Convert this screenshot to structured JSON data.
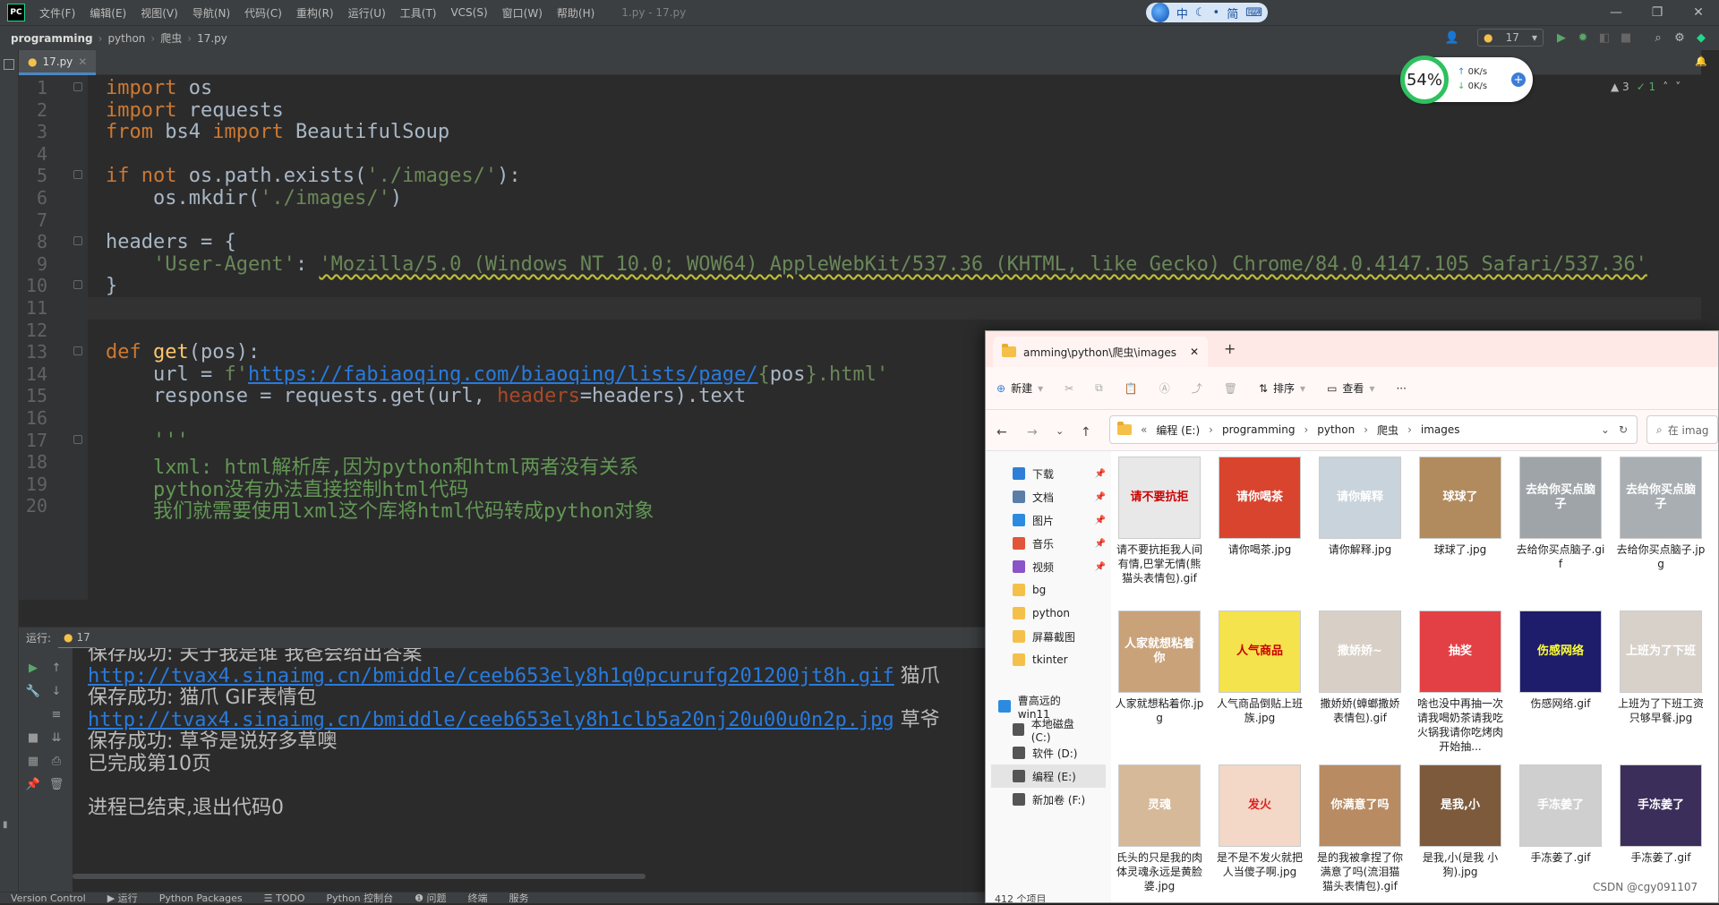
{
  "menubar": {
    "logo": "PC",
    "items": [
      "文件(F)",
      "编辑(E)",
      "视图(V)",
      "导航(N)",
      "代码(C)",
      "重构(R)",
      "运行(U)",
      "工具(T)",
      "VCS(S)",
      "窗口(W)",
      "帮助(H)"
    ],
    "window_title": "1.py - 17.py",
    "ime": [
      "中",
      "简"
    ]
  },
  "navbar": {
    "crumbs": [
      "programming",
      "python",
      "爬虫",
      "17.py"
    ],
    "run_config": "17"
  },
  "editor": {
    "tab": "17.py",
    "inspect": [
      "▲ 3",
      "✓ 1"
    ],
    "lines": [
      {
        "n": "1",
        "html": "<span class='kw'>import</span> os"
      },
      {
        "n": "2",
        "html": "<span class='kw'>import</span> requests"
      },
      {
        "n": "3",
        "html": "<span class='kw'>from</span> bs4 <span class='kw'>import</span> BeautifulSoup"
      },
      {
        "n": "4",
        "html": ""
      },
      {
        "n": "5",
        "html": "<span class='kw'>if not</span> os.path.exists(<span class='str'>'./images/'</span>):"
      },
      {
        "n": "6",
        "html": "    os.mkdir(<span class='str'>'./images/'</span>)"
      },
      {
        "n": "7",
        "html": ""
      },
      {
        "n": "8",
        "html": "headers = {"
      },
      {
        "n": "9",
        "html": "    <span class='str'>'User-Agent'</span>: <span class='str wavy'>'Mozilla/5.0 (Windows NT 10.0; WOW64) AppleWebKit/537.36 (KHTML, like Gecko) Chrome/84.0.4147.105 Safari/537.36'</span>"
      },
      {
        "n": "10",
        "html": "}"
      },
      {
        "n": "11",
        "html": ""
      },
      {
        "n": "12",
        "html": ""
      },
      {
        "n": "13",
        "html": "<span class='kw'>def</span> <span class='fn'>get</span>(pos):"
      },
      {
        "n": "14",
        "html": "    url = <span class='str'>f'<span class='url'>https://fabiaoqing.com/biaoqing/lists/page/</span>{</span>pos<span class='str'>}.html'</span>"
      },
      {
        "n": "15",
        "html": "    response = requests.get(url, <span class='param'>headers</span>=headers).text"
      },
      {
        "n": "16",
        "html": ""
      },
      {
        "n": "17",
        "html": "    <span class='cmt'>'''</span>"
      },
      {
        "n": "18",
        "html": "    <span class='cmt'>lxml: html解析库,因为python和html两者没有关系</span>"
      },
      {
        "n": "19",
        "html": "    <span class='cmt'>python没有办法直接控制html代码</span>"
      },
      {
        "n": "20",
        "html": "    <span class='cmt'>我们就需要使用lxml这个库将html代码转成python对象</span>"
      }
    ]
  },
  "netwidget": {
    "percent": "54%",
    "up": "0K/s",
    "down": "0K/s"
  },
  "run": {
    "label": "运行:",
    "tab": "17",
    "lines": [
      {
        "kind": "text",
        "text": "保存成功: 关于我是谁 我爸会给出答案"
      },
      {
        "kind": "url",
        "url": "http://tvax4.sinaimg.cn/bmiddle/ceeb653ely8h1q0pcurufg201200jt8h.gif",
        "rest": " 猫爪"
      },
      {
        "kind": "text",
        "text": "保存成功: 猫爪 GIF表情包"
      },
      {
        "kind": "url",
        "url": "http://tvax4.sinaimg.cn/bmiddle/ceeb653ely8h1clb5a20nj20u00u0n2p.jpg",
        "rest": " 草爷"
      },
      {
        "kind": "text",
        "text": "保存成功: 草爷是说好多草噢"
      },
      {
        "kind": "text",
        "text": "已完成第10页"
      },
      {
        "kind": "text",
        "text": ""
      },
      {
        "kind": "text",
        "text": "进程已结束,退出代码0"
      }
    ]
  },
  "bottombar": [
    "Version Control",
    "▶ 运行",
    "Python Packages",
    "☰ TODO",
    "Python 控制台",
    "❶ 问题",
    "终端",
    "服务"
  ],
  "explorer": {
    "tab": "amming\\python\\爬虫\\images",
    "commands": [
      "新建",
      "排序",
      "查看",
      "···"
    ],
    "path": [
      "编程 (E:)",
      "programming",
      "python",
      "爬虫",
      "images"
    ],
    "search_placeholder": "在 imag",
    "sidebar": [
      {
        "label": "下载",
        "color": "#2f7fd6",
        "pin": true
      },
      {
        "label": "文档",
        "color": "#5a7ea8",
        "pin": true
      },
      {
        "label": "图片",
        "color": "#2c8be0",
        "pin": true
      },
      {
        "label": "音乐",
        "color": "#e2553a",
        "pin": true
      },
      {
        "label": "视频",
        "color": "#8a53c7",
        "pin": true
      },
      {
        "label": "bg",
        "color": "#f5c04a",
        "pin": false
      },
      {
        "label": "python",
        "color": "#f5c04a",
        "pin": false
      },
      {
        "label": "屏幕截图",
        "color": "#f5c04a",
        "pin": false
      },
      {
        "label": "tkinter",
        "color": "#f5c04a",
        "pin": false
      },
      {
        "label": "曹高远的win11",
        "color": "#2c8be0",
        "pin": false
      },
      {
        "label": "本地磁盘 (C:)",
        "color": "#555",
        "pin": false
      },
      {
        "label": "软件 (D:)",
        "color": "#555",
        "pin": false
      },
      {
        "label": "编程 (E:)",
        "color": "#555",
        "pin": false
      },
      {
        "label": "新加卷 (F:)",
        "color": "#555",
        "pin": false
      }
    ],
    "files": [
      {
        "name": "请不要抗拒我人间有情,巴掌无情(熊猫头表情包).gif",
        "bg": "#e8e8e8",
        "txt": "请不要抗拒",
        "tc": "#c00"
      },
      {
        "name": "请你喝茶.jpg",
        "bg": "#d9442f",
        "txt": "请你喝茶",
        "tc": "#fff"
      },
      {
        "name": "请你解释.jpg",
        "bg": "#c9d3dc",
        "txt": "请你解释",
        "tc": "#fff"
      },
      {
        "name": "球球了.jpg",
        "bg": "#b18a5e",
        "txt": "球球了",
        "tc": "#fff"
      },
      {
        "name": "去给你买点脑子.gif",
        "bg": "#9ea4a8",
        "txt": "去给你买点脑子",
        "tc": "#fff"
      },
      {
        "name": "去给你买点脑子.jpg",
        "bg": "#a8aeb2",
        "txt": "去给你买点脑子",
        "tc": "#fff"
      },
      {
        "name": "人家就想粘着你.jpg",
        "bg": "#c9a27a",
        "txt": "人家就想粘着你",
        "tc": "#fff"
      },
      {
        "name": "人气商品倒贴上班族.jpg",
        "bg": "#f4e34c",
        "txt": "人气商品",
        "tc": "#c00"
      },
      {
        "name": "撒娇娇(蟑螂撒娇表情包).gif",
        "bg": "#d8cfc6",
        "txt": "撒娇娇~",
        "tc": "#fff"
      },
      {
        "name": "啥也没中再抽一次请我喝奶茶请我吃火锅我请你吃烤肉开始抽...",
        "bg": "#e34046",
        "txt": "抽奖",
        "tc": "#fff"
      },
      {
        "name": "伤感网络.gif",
        "bg": "#1d1d6b",
        "txt": "伤感网络",
        "tc": "#ff3"
      },
      {
        "name": "上班为了下班工资只够早餐.jpg",
        "bg": "#d7d1ca",
        "txt": "上班为了下班",
        "tc": "#fff"
      },
      {
        "name": "氏头的只是我的肉体灵魂永远是黄脸婆.jpg",
        "bg": "#d6b999",
        "txt": "灵魂",
        "tc": "#fff"
      },
      {
        "name": "是不是不发火就把人当傻子啊.jpg",
        "bg": "#f3d8c8",
        "txt": "发火",
        "tc": "#d22"
      },
      {
        "name": "是的我被拿捏了你满意了吗(流泪猫猫头表情包).gif",
        "bg": "#b88b62",
        "txt": "你满意了吗",
        "tc": "#fff"
      },
      {
        "name": "是我,小(是我 小狗).jpg",
        "bg": "#7d5a3c",
        "txt": "是我,小",
        "tc": "#fff"
      },
      {
        "name": "手冻姜了.gif",
        "bg": "#cfcfcf",
        "txt": "手冻姜了",
        "tc": "#fff"
      },
      {
        "name": "手冻姜了.gif",
        "bg": "#3b2e5a",
        "txt": "手冻姜了",
        "tc": "#fff"
      }
    ],
    "status": "412 个项目"
  },
  "watermark": "CSDN @cgy091107"
}
